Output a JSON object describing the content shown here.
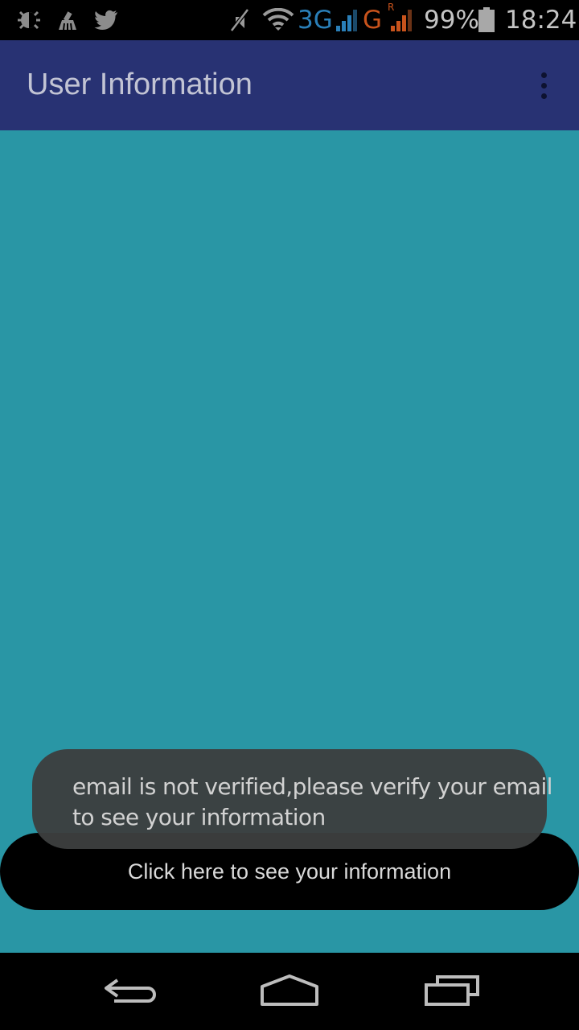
{
  "status_bar": {
    "battery_percent": "99%",
    "time": "18:24",
    "network_3g": "3G",
    "network_g": "G",
    "roaming": "R",
    "icons": [
      "debug-icon",
      "cleaner-icon",
      "twitter-icon",
      "mute-icon",
      "wifi-icon",
      "signal-3g-icon",
      "signal-g-icon",
      "battery-icon"
    ]
  },
  "app_bar": {
    "title": "User Information",
    "menu_icon": "overflow-menu-icon"
  },
  "main": {
    "button_label": "Click here to see your information"
  },
  "toast": {
    "line1": "email is not verified,please verify your email",
    "line2": "to see your information"
  },
  "nav_bar": {
    "icons": [
      "back-icon",
      "home-icon",
      "recents-icon"
    ]
  },
  "colors": {
    "app_bar": "#283273",
    "background": "#2996a5",
    "button": "#000000",
    "network_3g": "#2a7fb8",
    "network_g": "#c8531c"
  }
}
